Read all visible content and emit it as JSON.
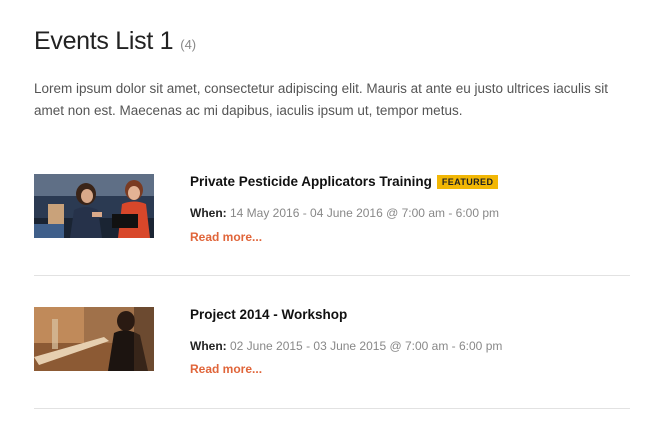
{
  "header": {
    "title": "Events List 1",
    "count": "(4)"
  },
  "intro": "Lorem ipsum dolor sit amet, consectetur adipiscing elit. Mauris at ante eu justo ultrices iaculis sit amet non est. Maecenas ac mi dapibus, iaculis ipsum ut, tempor metus.",
  "events": [
    {
      "title": "Private Pesticide Applicators Training",
      "badge": "FEATURED",
      "when_label": "When:",
      "when_value": "14 May 2016 - 04 June 2016 @ 7:00 am - 6:00 pm",
      "read_more": "Read more..."
    },
    {
      "title": "Project 2014 - Workshop",
      "badge": "",
      "when_label": "When:",
      "when_value": "02 June 2015 - 03 June 2015 @ 7:00 am - 6:00 pm",
      "read_more": "Read more..."
    }
  ],
  "colors": {
    "accent_link": "#e0653a",
    "badge_bg": "#f2b705"
  }
}
